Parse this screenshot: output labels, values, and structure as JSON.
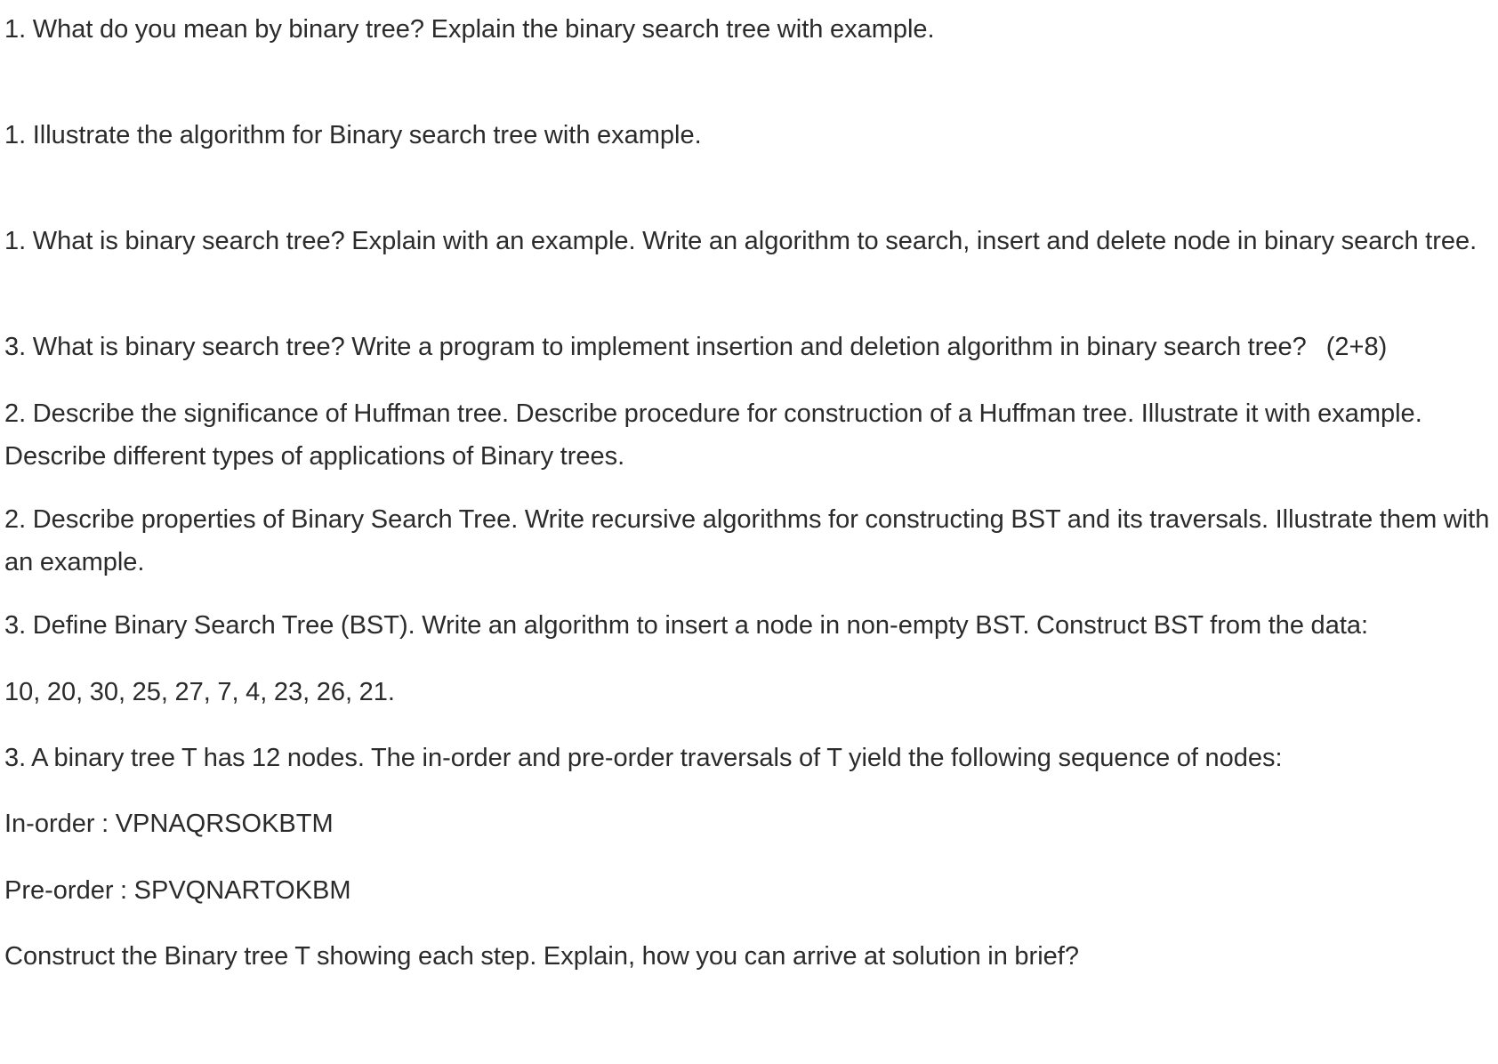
{
  "questions": [
    {
      "text": "1. What do you mean by binary tree? Explain the binary search tree with example."
    },
    {
      "text": "1. Illustrate the algorithm for Binary search tree with example."
    },
    {
      "text": "1. What is binary search tree? Explain with an example. Write an algorithm to search, insert and delete node in binary search tree."
    },
    {
      "text": "3. What is binary search tree? Write a program to implement insertion and deletion algorithm in binary search tree?",
      "marks": "(2+8)"
    },
    {
      "text": "2. Describe the significance of Huffman tree. Describe procedure for construction of a Huffman tree. Illustrate it with example. Describe different types of applications of Binary trees."
    },
    {
      "text": "2. Describe properties of Binary Search Tree. Write recursive algorithms for constructing BST and its traversals. Illustrate them with an example."
    },
    {
      "text": "3. Define Binary Search Tree (BST). Write an algorithm to insert a node in non-empty BST. Construct BST from the data:"
    },
    {
      "text": "10, 20, 30, 25, 27, 7, 4, 23, 26, 21."
    },
    {
      "text": "3. A binary tree T has 12 nodes. The in-order and pre-order traversals of T yield the following sequence of nodes:"
    },
    {
      "text": "In-order : VPNAQRSOKBTM"
    },
    {
      "text": "Pre-order : SPVQNARTOKBM"
    },
    {
      "text": "Construct the Binary tree T showing each step. Explain, how you can arrive at solution in brief?"
    }
  ]
}
